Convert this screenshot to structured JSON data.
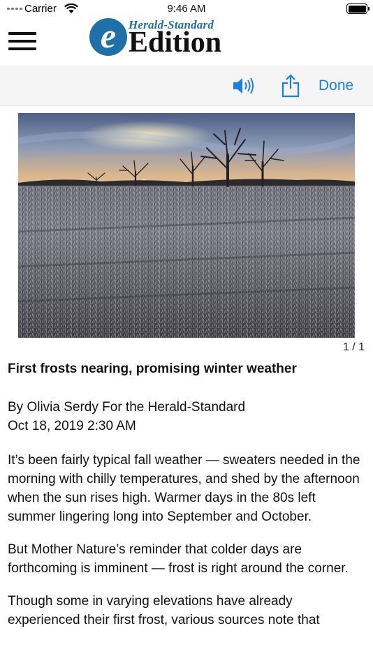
{
  "status_bar": {
    "carrier": "Carrier",
    "time": "9:46 AM"
  },
  "header": {
    "logo_e": "e",
    "logo_herald": "Herald-Standard",
    "logo_edition": "Edition",
    "brand_color": "#1f6fa8"
  },
  "toolbar": {
    "speaker_icon": "speaker-icon",
    "share_icon": "share-icon",
    "done_label": "Done",
    "accent_color": "#1a7fe0"
  },
  "photo": {
    "counter": "1 / 1"
  },
  "article": {
    "headline": "First frosts nearing, promising winter weather",
    "byline": "By Olivia Serdy For the Herald-Standard",
    "date": "Oct 18, 2019 2:30 AM",
    "paragraphs": [
      "It’s been fairly typical fall weather — sweaters needed in the morning with chilly temperatures, and shed by the afternoon when the sun rises high. Warmer days in the 80s left summer lingering long into September and October.",
      "But Mother Nature’s reminder that colder days are forthcoming is imminent — frost is right around the corner.",
      "Though some in varying elevations have already experienced their first frost, various sources note that"
    ]
  }
}
